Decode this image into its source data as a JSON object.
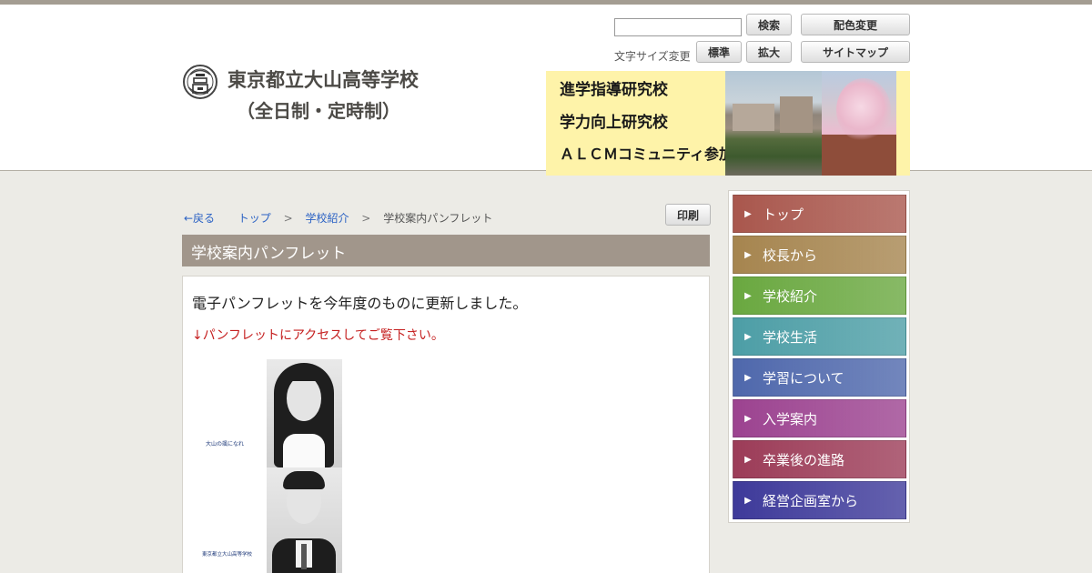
{
  "header": {
    "school_name": "東京都立大山高等学校",
    "school_sub": "（全日制・定時制）",
    "search_button": "検索",
    "color_change_button": "配色変更",
    "font_size_label": "文字サイズ変更",
    "font_standard_button": "標準",
    "font_large_button": "拡大",
    "sitemap_button": "サイトマップ",
    "banner_lines": [
      "進学指導研究校",
      "学力向上研究校",
      "ＡＬＣＭコミュニティ参加校"
    ]
  },
  "breadcrumb": {
    "back": "←戻る",
    "top": "トップ",
    "sep1": ">",
    "intro": "学校紹介",
    "sep2": ">",
    "current": "学校案内パンフレット"
  },
  "print_button": "印刷",
  "page_title": "学校案内パンフレット",
  "content": {
    "lead": "電子パンフレットを今年度のものに更新しました。",
    "note": "↓パンフレットにアクセスしてご覧下さい。",
    "pamphlet_caption": "大山の颯になれ",
    "pamphlet_school": "東京都立大山高等学校"
  },
  "sidebar": {
    "items": [
      {
        "label": "トップ",
        "color": "#a9574d"
      },
      {
        "label": "校長から",
        "color": "#a6854f"
      },
      {
        "label": "学校紹介",
        "color": "#6aa840"
      },
      {
        "label": "学校生活",
        "color": "#4d9ea6"
      },
      {
        "label": "学習について",
        "color": "#4f68ac"
      },
      {
        "label": "入学案内",
        "color": "#9c4390"
      },
      {
        "label": "卒業後の進路",
        "color": "#9c3c58"
      },
      {
        "label": "経営企画室から",
        "color": "#3e3a9a"
      }
    ]
  },
  "colors": {
    "title_bar": "#a1968b",
    "link": "#2b62c4",
    "note_red": "#c51f1f"
  }
}
